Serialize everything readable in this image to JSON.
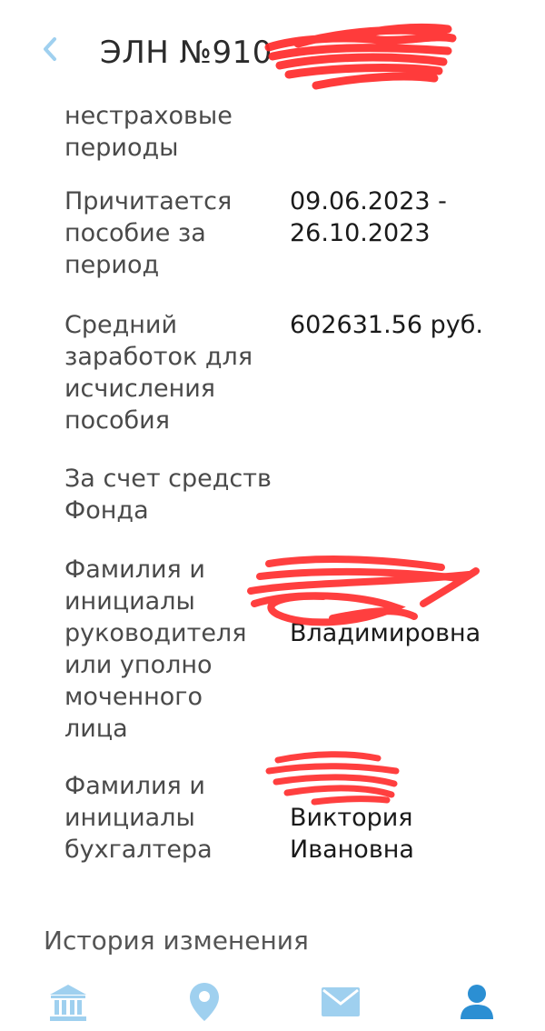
{
  "header": {
    "title": "ЭЛН №910"
  },
  "details": {
    "rows": [
      {
        "label": "нестраховые периоды",
        "value": ""
      },
      {
        "label": "Причитается пособие за период",
        "value": "09.06.2023 - 26.10.2023"
      },
      {
        "label": "Средний заработок для исчисления пособия",
        "value": "602631.56 руб."
      },
      {
        "label": "За счет средств Фонда",
        "value": ""
      },
      {
        "label": "Фамилия и инициалы руководителя или уполно моченного лица",
        "value": "Владимировна"
      },
      {
        "label": "Фамилия и инициалы бухгалтера",
        "value": "Виктория Ивановна"
      }
    ]
  },
  "history": {
    "title": "История изменения"
  },
  "colors": {
    "accent": "#9fd0ef",
    "active": "#2b8fd3",
    "redaction": "#ff2a2a"
  },
  "icons": {
    "back": "chevron-left-icon",
    "nav": [
      "bank-icon",
      "location-pin-icon",
      "mail-icon",
      "user-icon"
    ]
  }
}
